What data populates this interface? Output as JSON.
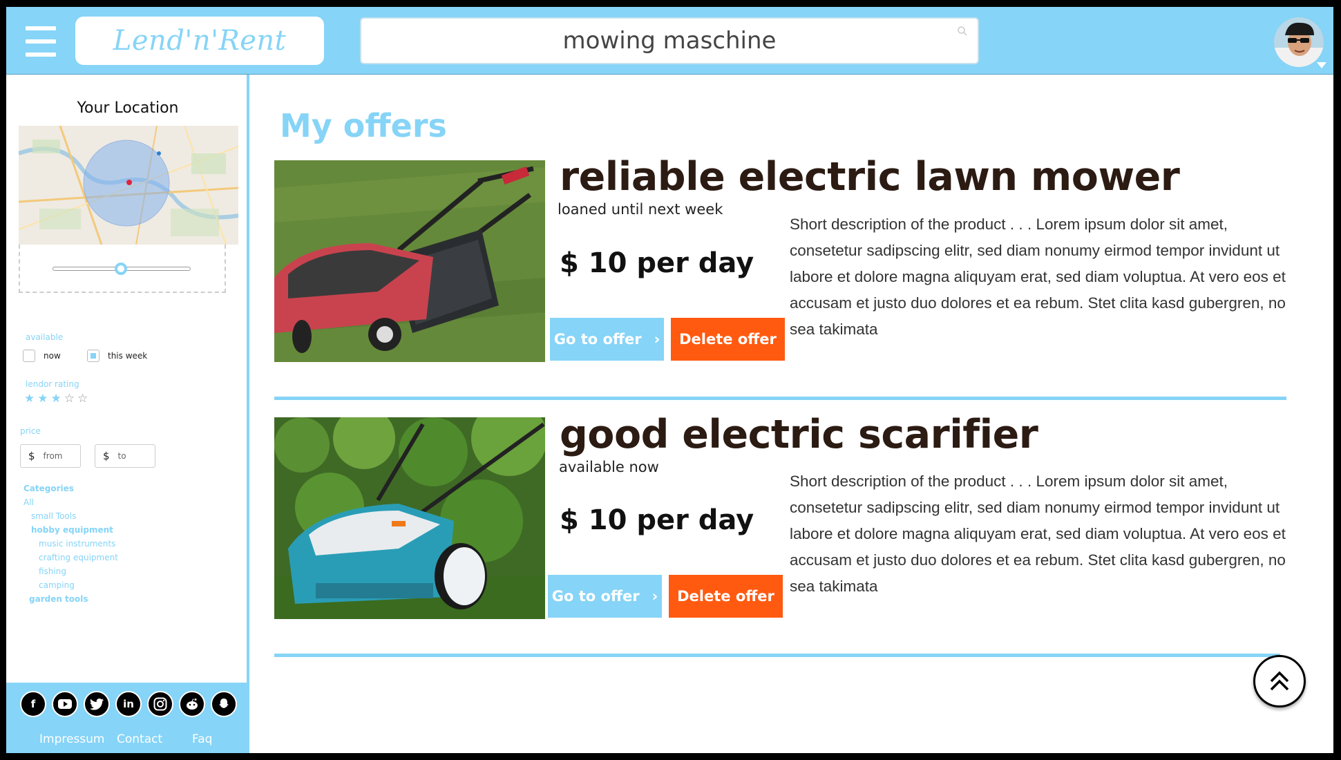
{
  "header": {
    "logo_text": "Lend'n'Rent",
    "search_value": "mowing maschine",
    "menu_icon": "hamburger-icon",
    "search_icon": "search-icon",
    "avatar_icon": "avatar"
  },
  "sidebar": {
    "location_title": "Your Location",
    "filters": {
      "available_label": "available",
      "available_options": [
        {
          "label": "now",
          "checked": false
        },
        {
          "label": "this week",
          "checked": true
        }
      ],
      "rating_label": "lendor rating",
      "rating": 3,
      "rating_max": 5,
      "price_label": "price",
      "price_currency": "$",
      "price_from_placeholder": "from",
      "price_to_placeholder": "to"
    },
    "categories": {
      "title": "Categories",
      "all": "All",
      "small_tools": "small Tools",
      "hobby_equipment": "hobby equipment",
      "music_instruments": "music instruments",
      "crafting_equipment": "crafting equipment",
      "fishing": "fishing",
      "camping": "camping",
      "garden_tools": "garden tools"
    },
    "footer": {
      "socials": [
        "facebook-icon",
        "youtube-icon",
        "twitter-icon",
        "linkedin-icon",
        "instagram-icon",
        "reddit-icon",
        "snapchat-icon"
      ],
      "impressum": "Impressum",
      "contact": "Contact",
      "faq": "Faq"
    }
  },
  "main": {
    "title": "My offers",
    "offers": [
      {
        "title": "reliable electric lawn mower",
        "status": "loaned until next week",
        "price": "$ 10 per day",
        "description": "Short description of the product  . . . Lorem ipsum dolor sit amet, consetetur sadipscing elitr, sed diam nonumy eirmod tempor invidunt ut labore et dolore magna aliquyam erat, sed diam voluptua. At vero eos et accusam et justo duo dolores et ea rebum. Stet clita kasd gubergren, no sea takimata",
        "go_label": "Go to offer",
        "delete_label": "Delete offer"
      },
      {
        "title": "good electric scarifier",
        "status": "available now",
        "price": "$ 10 per day",
        "description": "Short description of the product  . . . Lorem ipsum dolor sit amet, consetetur sadipscing elitr, sed diam nonumy eirmod tempor invidunt ut labore et dolore magna aliquyam erat, sed diam voluptua. At vero eos et accusam et justo duo dolores et ea rebum. Stet clita kasd gubergren, no sea takimata",
        "go_label": "Go to offer",
        "delete_label": "Delete offer"
      }
    ]
  },
  "colors": {
    "accent": "#86d4f7",
    "delete": "#ff5a10",
    "title_dark": "#2b1b13"
  }
}
